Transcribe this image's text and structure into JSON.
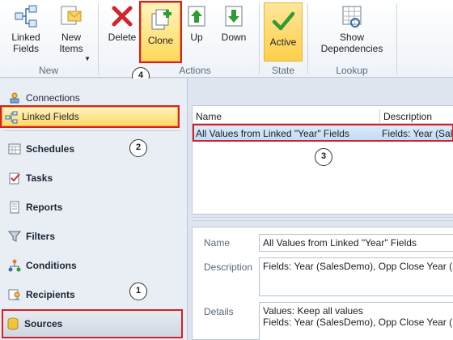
{
  "ribbon": {
    "new_group": {
      "label": "New",
      "linked_fields": "Linked Fields",
      "new_items": "New Items"
    },
    "actions_group": {
      "label": "Actions",
      "delete": "Delete",
      "clone": "Clone",
      "up": "Up",
      "down": "Down"
    },
    "state_group": {
      "label": "State",
      "active": "Active"
    },
    "lookup_group": {
      "label": "Lookup",
      "show_dependencies": "Show Dependencies"
    }
  },
  "callouts": [
    "1",
    "2",
    "3",
    "4"
  ],
  "sidebar": {
    "items": [
      {
        "label": "Connections",
        "icon": "connections-icon"
      },
      {
        "label": "Linked Fields",
        "icon": "linked-fields-icon",
        "selected": true
      },
      {
        "label": "Schedules",
        "icon": "schedules-icon"
      },
      {
        "label": "Tasks",
        "icon": "tasks-icon"
      },
      {
        "label": "Reports",
        "icon": "reports-icon"
      },
      {
        "label": "Filters",
        "icon": "filter-icon"
      },
      {
        "label": "Conditions",
        "icon": "conditions-icon"
      },
      {
        "label": "Recipients",
        "icon": "recipients-icon"
      },
      {
        "label": "Sources",
        "icon": "database-icon"
      }
    ]
  },
  "grid": {
    "columns": [
      "Name",
      "Description"
    ],
    "rows": [
      {
        "name": "All Values from Linked \"Year\" Fields",
        "description": "Fields: Year (SalesDemo"
      }
    ]
  },
  "details": {
    "name_label": "Name",
    "name_value": "All Values from Linked \"Year\" Fields",
    "description_label": "Description",
    "description_value": "Fields: Year (SalesDemo), Opp Close Year (Sal",
    "details_label": "Details",
    "details_line1": "Values: Keep all values",
    "details_line2": "Fields: Year (SalesDemo), Opp Close Year (Sal"
  },
  "colors": {
    "highlight_red": "#d81f26",
    "selection_yellow": "#ffd869",
    "row_blue": "#c2dcf7"
  }
}
